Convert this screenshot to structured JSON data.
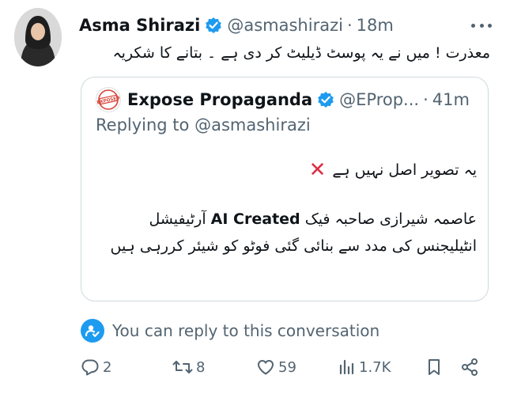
{
  "tweet": {
    "author_name": "Asma Shirazi",
    "handle": "@asmashirazi",
    "separator": "·",
    "time": "18m",
    "text": "معذرت ! میں نے یہ پوسٹ ڈیلیٹ کر دی ہے ۔ بتانے کا شکریہ"
  },
  "quote": {
    "author_name": "Expose Propaganda",
    "handle": "@EProp...",
    "separator": "·",
    "time": "41m",
    "reply_prefix": "Replying to",
    "reply_mention": "@asmashirazi",
    "line1": "یہ تصویر اصل نہیں ہے",
    "line1_mark": "✕",
    "body_part1": "عاصمہ شیرازی صاحبہ فیک",
    "body_highlight": "AI Created",
    "body_part2": "آرٹیفیشل انٹیلیجنس کی مدد سے بنائی گئی فوٹو کو شیئر کررہی ہیں"
  },
  "conversation": {
    "text": "You can reply to this conversation"
  },
  "actions": {
    "replies": "2",
    "reposts": "8",
    "likes": "59",
    "views": "1.7K"
  },
  "colors": {
    "verified": "#1d9bf0",
    "secondary_text": "#536471",
    "border": "#cfd9de",
    "cross": "#dd2e44",
    "accent": "#1d9bf0"
  }
}
